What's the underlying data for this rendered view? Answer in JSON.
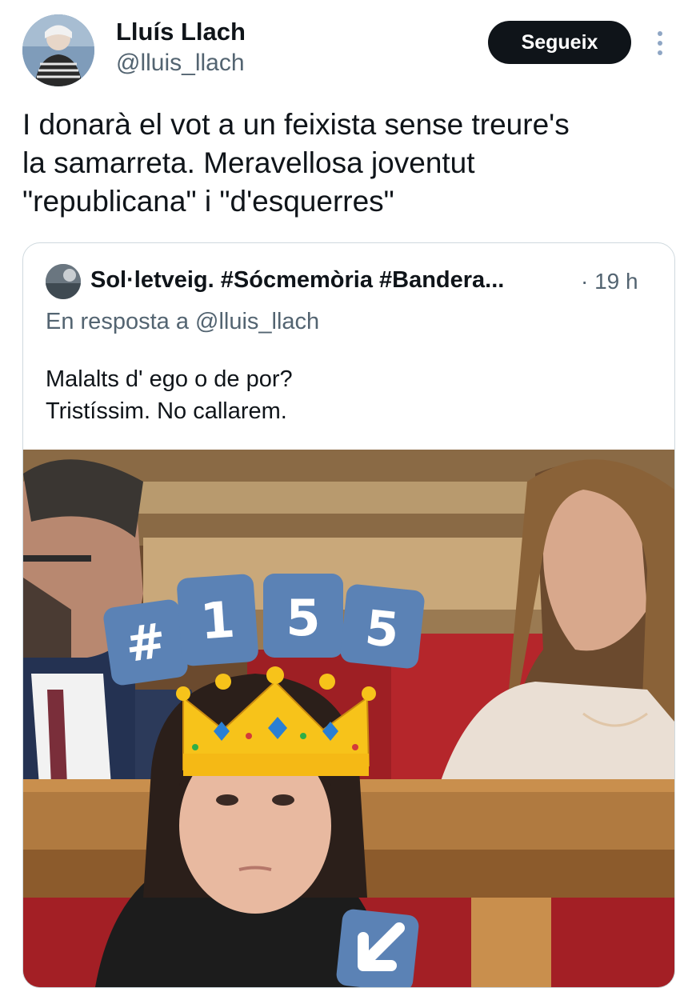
{
  "tweet": {
    "author": {
      "name": "Lluís Llach",
      "handle": "@lluis_llach"
    },
    "follow_label": "Segueix",
    "text": "I  donarà el vot a un feixista sense treure's\nla samarreta. Meravellosa joventut\n\"republicana\" i \"d'esquerres\""
  },
  "quoted": {
    "author_name": "Sol·letveig. #Sócmemòria #Bandera...",
    "time": "· 19 h",
    "reply_to": "En resposta a @lluis_llach",
    "text": "Malalts d' ego o de por?\nTristíssim. No callarem.",
    "image": {
      "badges": [
        "#",
        "1",
        "5",
        "5"
      ],
      "overlay_icons": [
        "crown-icon",
        "arrow-down-left-icon"
      ]
    }
  },
  "colors": {
    "text_primary": "#0f1419",
    "text_secondary": "#536471",
    "follow_button_bg": "#0f1419",
    "border": "#cfd9de",
    "badge_blue": "#5b82b5",
    "crown_gold": "#f7c31a"
  }
}
